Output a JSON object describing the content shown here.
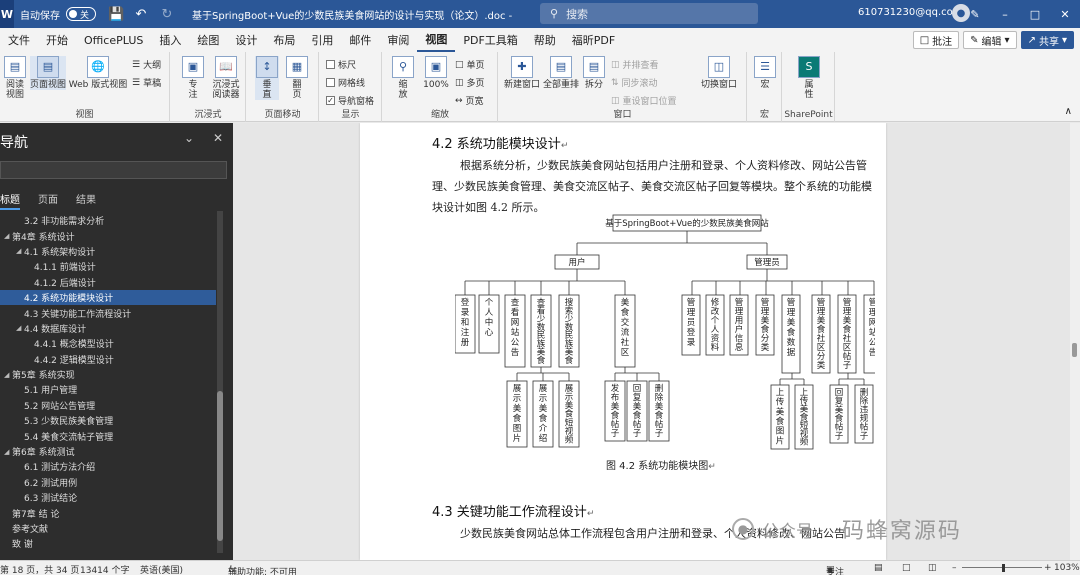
{
  "titlebar": {
    "app_glyph": "W",
    "autosave_label": "自动保存",
    "autosave_state": "关",
    "doc_title": "基于SpringBoot+Vue的少数民族美食网站的设计与实现（论文）.doc - 兼容性...",
    "search_placeholder": "搜索",
    "user_email": "610731230@qq.com",
    "icons": [
      "save-icon",
      "undo-icon",
      "redo-icon",
      "search-icon",
      "avatar-icon",
      "pen-icon",
      "minimize-icon",
      "maximize-icon",
      "close-icon"
    ]
  },
  "menubar": {
    "items": [
      "文件",
      "开始",
      "OfficePLUS",
      "插入",
      "绘图",
      "设计",
      "布局",
      "引用",
      "邮件",
      "审阅",
      "视图",
      "PDF工具箱",
      "帮助",
      "福昕PDF"
    ],
    "active": "视图",
    "comments_label": "批注",
    "editing_label": "编辑",
    "share_label": "共享"
  },
  "ribbon": {
    "views_group": {
      "label": "视图",
      "buttons": [
        "阅读\n视图",
        "页面视图",
        "Web 版式视图"
      ],
      "small": [
        "大纲",
        "草稿"
      ]
    },
    "immersive_group": {
      "label": "沉浸式",
      "buttons": [
        "专\n注",
        "沉浸式\n阅读器"
      ]
    },
    "pagemove_group": {
      "label": "页面移动",
      "buttons": [
        "垂\n直",
        "翻\n页"
      ]
    },
    "show_group": {
      "label": "显示",
      "checks": [
        {
          "label": "标尺",
          "checked": false
        },
        {
          "label": "网格线",
          "checked": false
        },
        {
          "label": "导航窗格",
          "checked": true
        }
      ]
    },
    "zoom_group": {
      "label": "缩放",
      "buttons": [
        "缩\n放",
        "100%"
      ],
      "small": [
        "单页",
        "多页",
        "页宽"
      ]
    },
    "window_group": {
      "label": "窗口",
      "buttons": [
        "新建窗口",
        "全部重排",
        "拆分"
      ],
      "small": [
        "并排查看",
        "同步滚动",
        "重设窗口位置"
      ],
      "switch_label": "切换窗口"
    },
    "macro_group": {
      "label": "宏",
      "button": "宏"
    },
    "sharepoint_group": {
      "label": "SharePoint",
      "button": "属\n性"
    }
  },
  "nav": {
    "title": "导航",
    "tabs": [
      "标题",
      "页面",
      "结果"
    ],
    "active_tab": "标题",
    "tree": [
      {
        "text": "3.2  非功能需求分析",
        "level": 1,
        "expander": false
      },
      {
        "text": "第4章 系统设计",
        "level": 0,
        "expander": true
      },
      {
        "text": "4.1  系统架构设计",
        "level": 1,
        "expander": true
      },
      {
        "text": "4.1.1  前端设计",
        "level": 2,
        "expander": false
      },
      {
        "text": "4.1.2  后端设计",
        "level": 2,
        "expander": false
      },
      {
        "text": "4.2  系统功能模块设计",
        "level": 1,
        "expander": false,
        "selected": true
      },
      {
        "text": "4.3  关键功能工作流程设计",
        "level": 1,
        "expander": false
      },
      {
        "text": "4.4  数据库设计",
        "level": 1,
        "expander": true
      },
      {
        "text": "4.4.1  概念模型设计",
        "level": 2,
        "expander": false
      },
      {
        "text": "4.4.2  逻辑模型设计",
        "level": 2,
        "expander": false
      },
      {
        "text": "第5章 系统实现",
        "level": 0,
        "expander": true
      },
      {
        "text": "5.1  用户管理",
        "level": 1,
        "expander": false
      },
      {
        "text": "5.2  网站公告管理",
        "level": 1,
        "expander": false
      },
      {
        "text": "5.3  少数民族美食管理",
        "level": 1,
        "expander": false
      },
      {
        "text": "5.4  美食交流帖子管理",
        "level": 1,
        "expander": false
      },
      {
        "text": "第6章 系统测试",
        "level": 0,
        "expander": true
      },
      {
        "text": "6.1  测试方法介绍",
        "level": 1,
        "expander": false
      },
      {
        "text": "6.2  测试用例",
        "level": 1,
        "expander": false
      },
      {
        "text": "6.3  测试结论",
        "level": 1,
        "expander": false
      },
      {
        "text": "第7章  结  论",
        "level": 0,
        "expander": false
      },
      {
        "text": "参考文献",
        "level": 0,
        "expander": false
      },
      {
        "text": "致  谢",
        "level": 0,
        "expander": false
      }
    ]
  },
  "document": {
    "heading_42": "4.2   系统功能模块设计",
    "para_1": "根据系统分析，少数民族美食网站包括用户注册和登录、个人资料修改、网站公告管理、少数民族美食管理、美食交流区帖子、美食交流区帖子回复等模块。整个系统的功能模块设计如图 4.2 所示。",
    "diagram": {
      "root": "基于SpringBoot+Vue的少数民族美食网站",
      "user": "用户",
      "admin": "管理员",
      "user_children": [
        "登录和注册",
        "个人中心",
        "查看网站公告",
        "查看少数民族美食",
        "搜索少数民族美食",
        "美食交流社区"
      ],
      "user_sub_food": [
        "展示美食图片",
        "展示美食介绍",
        "展示美食短视频"
      ],
      "user_sub_community": [
        "发布美食帖子",
        "回复美食帖子",
        "删除美食帖子"
      ],
      "admin_children": [
        "管理员登录",
        "修改个人资料",
        "管理用户信息",
        "管理美食分类",
        "管理美食数据",
        "管理美食社区分类",
        "管理美食社区帖子",
        "管理网站公告"
      ],
      "admin_sub_food": [
        "上传美食图片",
        "上传美食短视频"
      ],
      "admin_sub_community": [
        "回复美食帖子",
        "删除违规帖子"
      ]
    },
    "figure_caption": "图 4.2  系统功能模块图",
    "heading_43": "4.3   关键功能工作流程设计",
    "para_2": "少数民族美食网站总体工作流程包含用户注册和登录、个人资料修改、网站公告"
  },
  "watermark": {
    "left": "公众号 ·",
    "right": "码蜂窝源码"
  },
  "statusbar": {
    "page": "第 18 页，共 34 页",
    "words": "13414 个字",
    "language": "英语(美国)",
    "accessibility": "辅助功能: 不可用",
    "focus": "专注",
    "zoom": "103%"
  }
}
